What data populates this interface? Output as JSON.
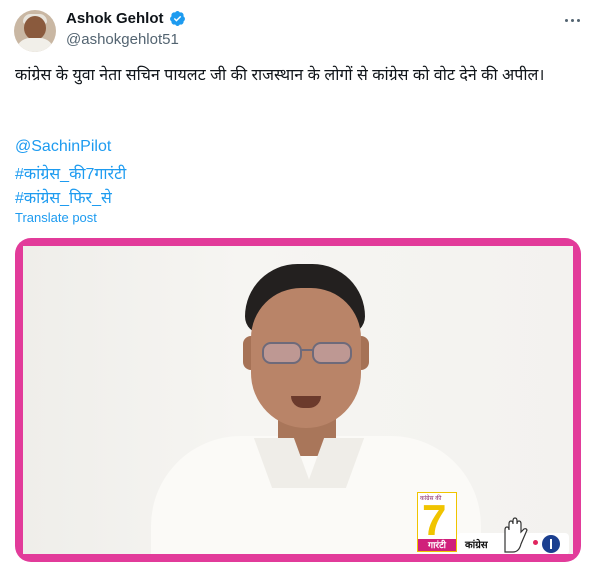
{
  "author": {
    "name": "Ashok Gehlot",
    "handle": "@ashokgehlot51",
    "verified_icon": "verified-badge-icon",
    "verified_color": "#1d9bf0"
  },
  "post": {
    "text": "कांग्रेस के युवा नेता सचिन पायलट जी की राजस्थान के लोगों से कांग्रेस को वोट देने की अपील।",
    "mention": "@SachinPilot",
    "hashtags": [
      "#कांग्रेस_की7गारंटी",
      "#कांग्रेस_फिर_से"
    ],
    "translate_label": "Translate post"
  },
  "media": {
    "frame_color": "#e23b9a",
    "logo_top_text": "कांग्रेस की",
    "logo_number": "7",
    "logo_bottom_text": "गारंटी",
    "party_label": "कांग्रेस"
  },
  "colors": {
    "link": "#1d9bf0",
    "secondary_text": "#536471"
  }
}
